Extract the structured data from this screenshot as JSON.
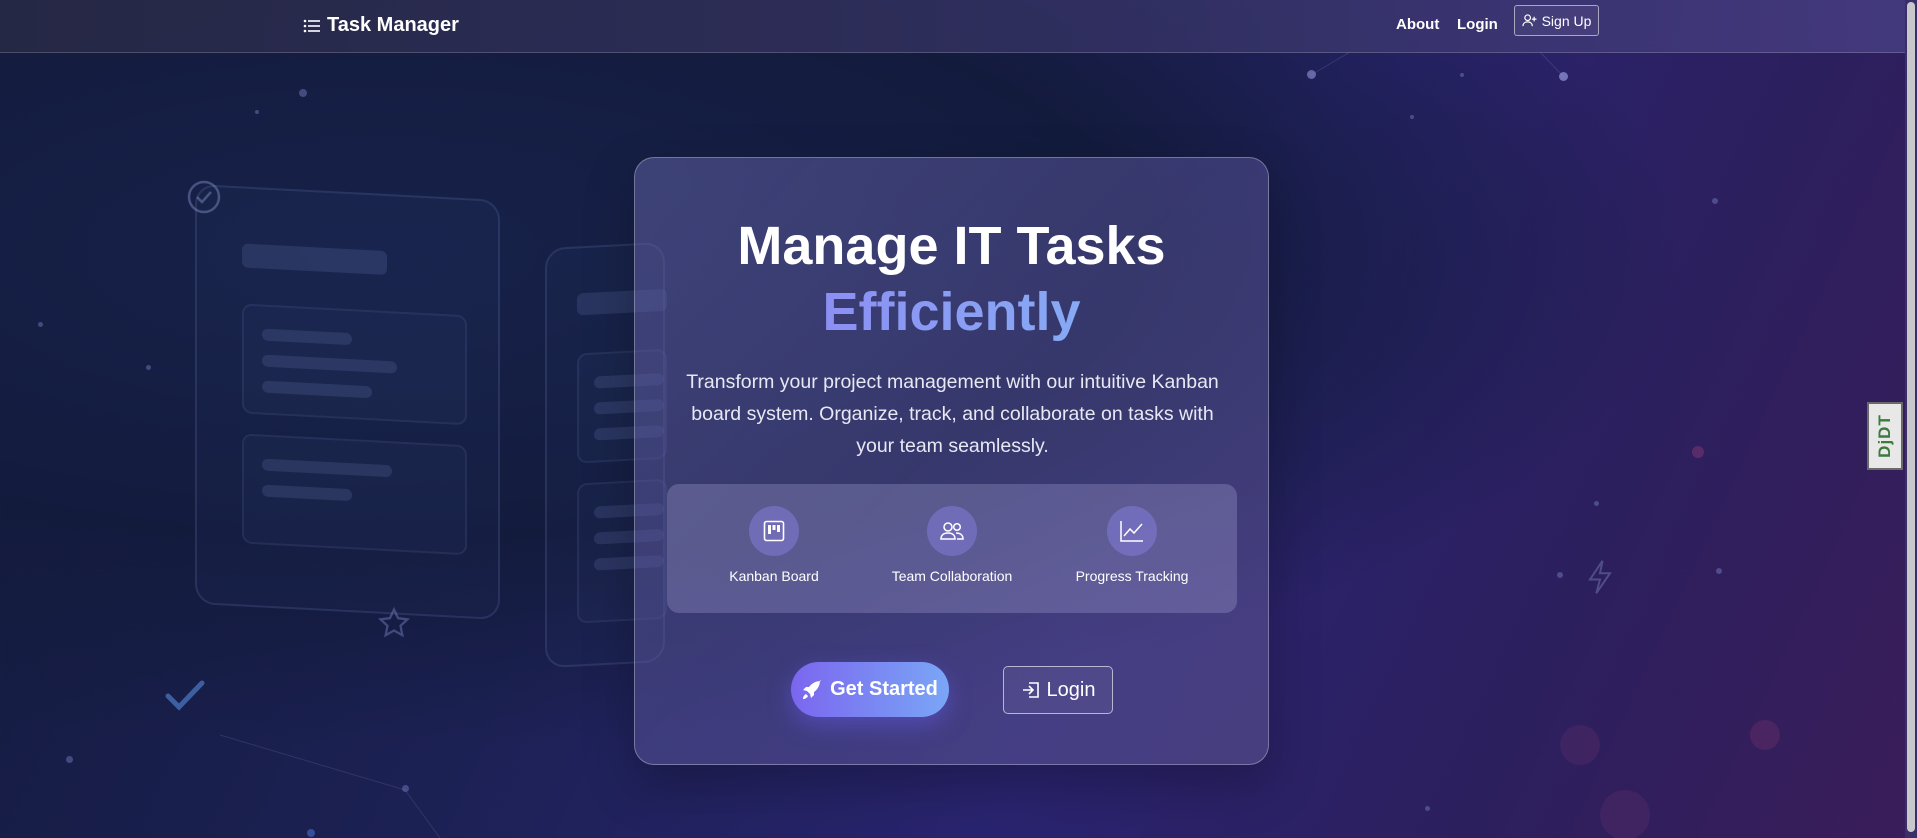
{
  "navbar": {
    "brand_icon": "list-icon",
    "brand": "Task Manager",
    "about": "About",
    "login": "Login",
    "signup_icon": "user-plus-icon",
    "signup": "Sign Up"
  },
  "hero": {
    "title_line1": "Manage IT Tasks",
    "title_line2": "Efficiently",
    "subtitle": "Transform your project management with our intuitive Kanban board system. Organize, track, and collaborate on tasks with your team seamlessly.",
    "features": [
      {
        "icon": "kanban-icon",
        "label": "Kanban Board"
      },
      {
        "icon": "people-icon",
        "label": "Team Collaboration"
      },
      {
        "icon": "graph-up-icon",
        "label": "Progress Tracking"
      }
    ],
    "get_started_icon": "rocket-icon",
    "get_started": "Get Started",
    "login_icon": "box-arrow-in-right-icon",
    "login": "Login"
  },
  "debug_toolbar": {
    "label": "DjDT"
  },
  "colors": {
    "accent_purple": "#7b66ef",
    "accent_blue": "#7aa6f6",
    "background_dark": "#131b3d"
  }
}
